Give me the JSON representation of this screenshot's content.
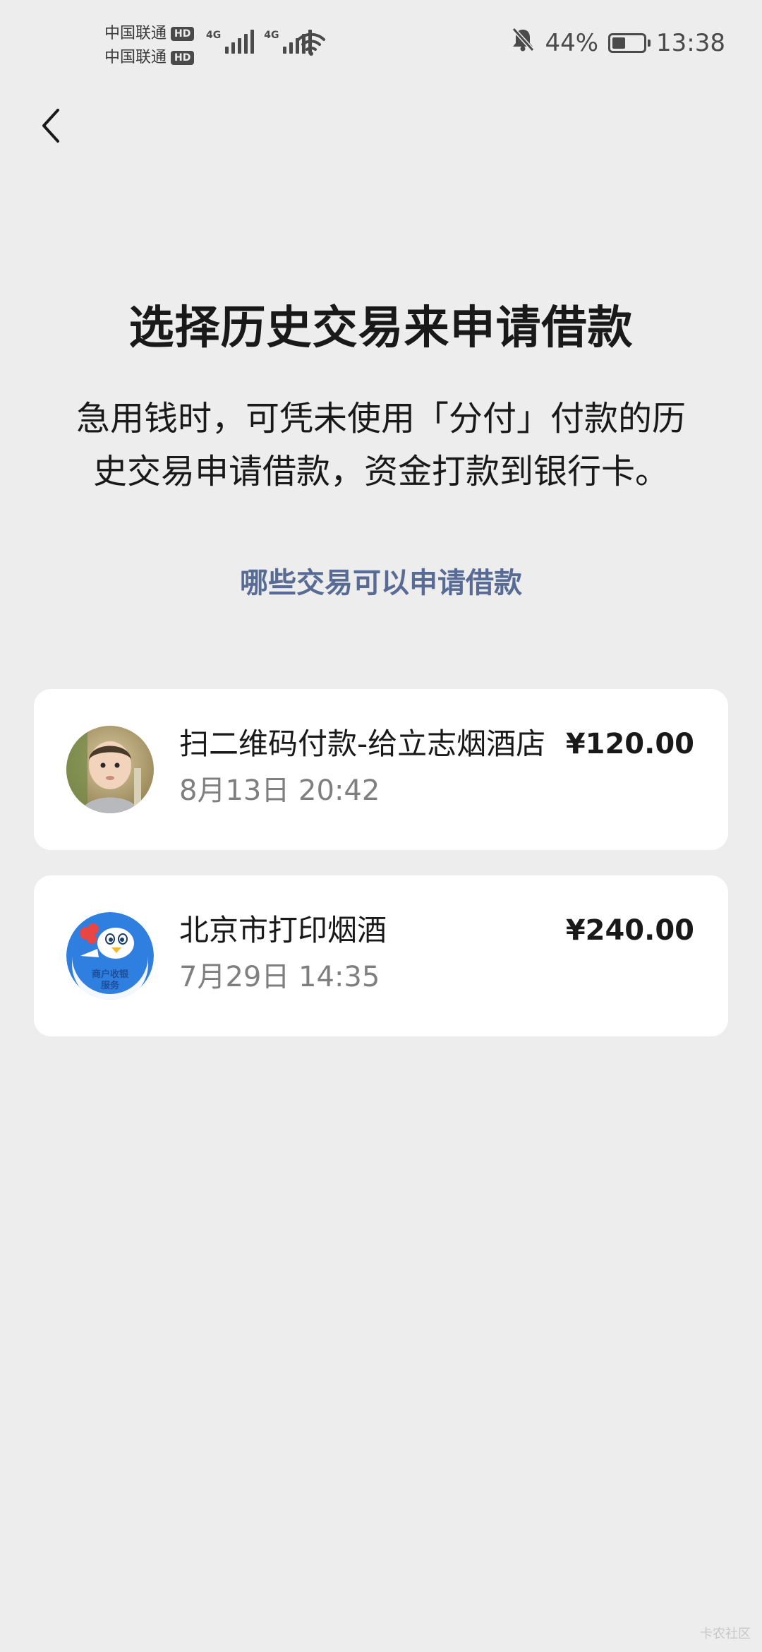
{
  "status_bar": {
    "carriers": [
      {
        "name": "中国联通",
        "badge": "HD"
      },
      {
        "name": "中国联通",
        "badge": "HD"
      }
    ],
    "network_labels": [
      "4G",
      "4G"
    ],
    "battery_percent": "44%",
    "battery_level": 0.44,
    "time": "13:38",
    "icons": [
      "signal-icon",
      "wifi-icon",
      "bell-muted-icon",
      "battery-icon"
    ]
  },
  "nav": {
    "back_icon": "chevron-left-icon"
  },
  "header": {
    "title": "选择历史交易来申请借款",
    "description": "急用钱时，可凭未使用「分付」付款的历史交易申请借款，资金打款到银行卡。",
    "help_link": "哪些交易可以申请借款"
  },
  "transactions": [
    {
      "name": "扫二维码付款-给立志烟酒店",
      "time": "8月13日 20:42",
      "amount": "¥120.00"
    },
    {
      "name": "北京市打印烟酒",
      "time": "7月29日 14:35",
      "amount": "¥240.00",
      "avatar_text_1": "商户收银",
      "avatar_text_2": "服务"
    }
  ],
  "watermark": "卡农社区",
  "colors": {
    "background": "#ededed",
    "card": "#ffffff",
    "link": "#576b95",
    "primary_text": "#191919",
    "secondary_text": "#7f7f7f"
  }
}
